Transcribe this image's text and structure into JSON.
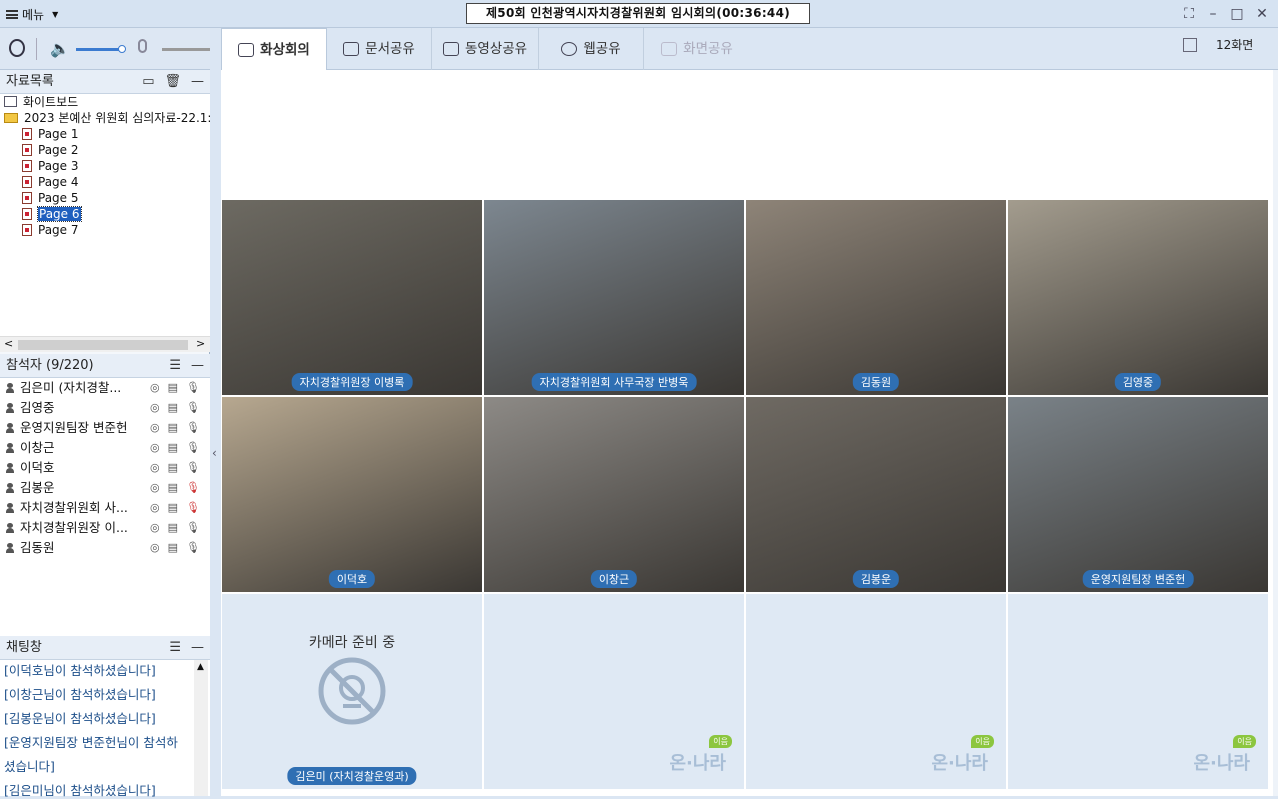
{
  "titlebar": {
    "menu_label": "메뉴",
    "title": "제50회 인천광역시자치경찰위원회 임시회의(00:36:44)"
  },
  "files": {
    "header": "자료목록",
    "items": [
      {
        "label": "화이트보드",
        "kind": "whiteboard"
      },
      {
        "label": "2023 본예산 위원회 심의자료-22.1:",
        "kind": "folder"
      },
      {
        "label": "Page 1",
        "kind": "page"
      },
      {
        "label": "Page 2",
        "kind": "page"
      },
      {
        "label": "Page 3",
        "kind": "page"
      },
      {
        "label": "Page 4",
        "kind": "page"
      },
      {
        "label": "Page 5",
        "kind": "page"
      },
      {
        "label": "Page 6",
        "kind": "page",
        "selected": true
      },
      {
        "label": "Page 7",
        "kind": "page"
      }
    ]
  },
  "participants": {
    "header": "참석자 (9/220)",
    "list": [
      {
        "name": "김은미 (자치경찰..."
      },
      {
        "name": "김영중"
      },
      {
        "name": "운영지원팀장 변준헌"
      },
      {
        "name": "이창근"
      },
      {
        "name": "이덕호"
      },
      {
        "name": "김봉운"
      },
      {
        "name": "자치경찰위원회 사..."
      },
      {
        "name": "자치경찰위원장 이..."
      },
      {
        "name": "김동원"
      }
    ]
  },
  "chat": {
    "header": "채팅창",
    "lines": [
      "[이덕호님이 참석하셨습니다]",
      "[이창근님이 참석하셨습니다]",
      "[김봉운님이 참석하셨습니다]",
      "[운영지원팀장 변준헌님이 참석하",
      "셨습니다]",
      "[김은미님이 참석하셨습니다]"
    ]
  },
  "tabs": [
    {
      "label": "화상회의",
      "active": true
    },
    {
      "label": "문서공유"
    },
    {
      "label": "동영상공유"
    },
    {
      "label": "웹공유"
    },
    {
      "label": "화면공유",
      "disabled": true
    }
  ],
  "layout_label": "12화면",
  "video": {
    "tiles": [
      {
        "label": "자치경찰위원장 이병록",
        "bg": "#6d6a62"
      },
      {
        "label": "자치경찰위원회 사무국장 반병욱",
        "bg": "#7d8790"
      },
      {
        "label": "김동원",
        "bg": "#8e8478"
      },
      {
        "label": "김영중",
        "bg": "#a39c8e"
      },
      {
        "label": "이덕호",
        "bg": "#b7a890"
      },
      {
        "label": "이창근",
        "bg": "#8d8a86"
      },
      {
        "label": "김봉운",
        "bg": "#6f6a63"
      },
      {
        "label": "운영지원팀장 변준헌",
        "bg": "#7a8288"
      }
    ],
    "camera_pending_text": "카메라 준비 중",
    "camera_pending_name": "김은미 (자치경찰운영과)",
    "logo_text": "온·나라",
    "logo_badge": "이음"
  }
}
